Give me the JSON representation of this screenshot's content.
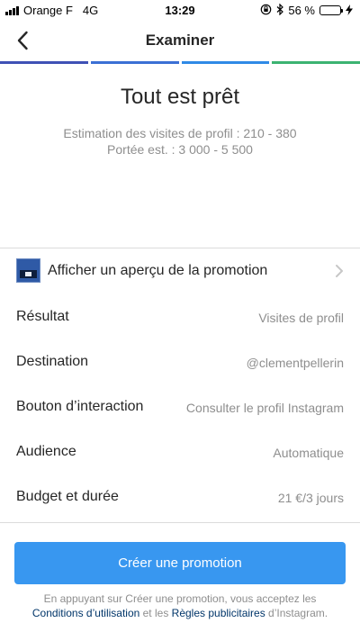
{
  "status_bar": {
    "carrier": "Orange F",
    "network": "4G",
    "time": "13:29",
    "battery_percent_text": "56 %",
    "battery_level": 0.56,
    "battery_color": "#4cd964",
    "icons": [
      "signal-bars-icon",
      "orientation-lock-icon",
      "bluetooth-icon",
      "battery-icon",
      "charging-bolt-icon"
    ]
  },
  "nav": {
    "title": "Examiner",
    "back_icon": "chevron-left-icon"
  },
  "progress": {
    "steps": 4,
    "colors": [
      "#3f51b5",
      "#3b6fd4",
      "#2f8ae6",
      "#3cb371"
    ]
  },
  "summary": {
    "headline": "Tout est prêt",
    "estimate_visits": "Estimation des visites de profil : 210 - 380",
    "estimate_reach": "Portée est. : 3 000 - 5 500"
  },
  "preview": {
    "label": "Afficher un aperçu de la promotion",
    "icon": "promotion-thumbnail-icon"
  },
  "details": [
    {
      "label": "Résultat",
      "value": "Visites de profil"
    },
    {
      "label": "Destination",
      "value": "@clementpellerin"
    },
    {
      "label": "Bouton d’interaction",
      "value": "Consulter le profil Instagram"
    },
    {
      "label": "Audience",
      "value": "Automatique"
    },
    {
      "label": "Budget et durée",
      "value": "21 €/3 jours"
    }
  ],
  "cta": {
    "label": "Créer une promotion",
    "color": "#3897f0"
  },
  "terms": {
    "prefix": "En appuyant sur Créer une promotion, vous acceptez les ",
    "link1": "Conditions d’utilisation",
    "middle": " et les ",
    "link2": "Règles publicitaires",
    "suffix": " d’Instagram.",
    "link_color": "#003569"
  }
}
